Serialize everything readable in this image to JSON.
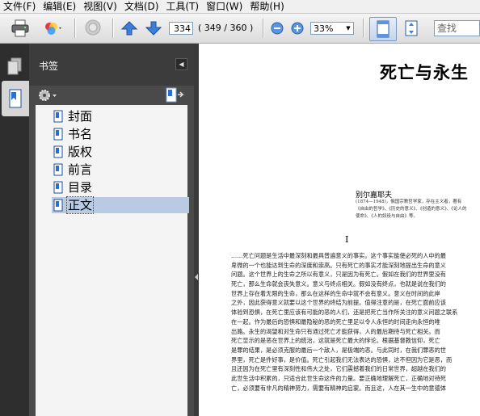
{
  "menu": [
    "文件(F)",
    "编辑(E)",
    "视图(V)",
    "文档(D)",
    "工具(T)",
    "窗口(W)",
    "帮助(H)"
  ],
  "toolbar": {
    "page_current": "334",
    "page_count": "( 349 / 360 )",
    "zoom": "33%",
    "find_placeholder": "查找",
    "icons": [
      "print-icon",
      "color-wheel-icon",
      "comment-icon",
      "previous-page-icon",
      "next-page-icon",
      "zoom-out-icon",
      "zoom-in-icon",
      "single-page-icon",
      "fit-page-icon"
    ]
  },
  "panel": {
    "title": "书签",
    "bookmarks": [
      {
        "label": "封面",
        "selected": false
      },
      {
        "label": "书名",
        "selected": false
      },
      {
        "label": "版权",
        "selected": false
      },
      {
        "label": "前言",
        "selected": false
      },
      {
        "label": "目录",
        "selected": false
      },
      {
        "label": "正文",
        "selected": true
      }
    ]
  },
  "document": {
    "title": "死亡与永生",
    "author": "别尔嘉耶夫",
    "author_note": "(1874—1948)，俄国宗教哲学家，存在主义者，著有《自由的哲学》、《历史的意义》、《创造的意义》、《论人的使命》、《人的奴役与自由》等。",
    "section": "I",
    "body_lines": [
      "……死亡问题是生活中最深刻和最具普遍意义的事实。这个事实能使必死的人中的最",
      "卑微的一个也能达到生命的深度和崇高。只有死亡的事实才能深刻地提出生命的意义",
      "问题。这个世界上的生命之所以有意义，只是因为有死亡。假如在我们的世界里没有",
      "死亡，那么生命就会丧失意义。意义与终点相关。假如没有终点，也就是说在我们的",
      "世界上存在着无限的生命，那么在这样的生命中就不会有意义。意义在时间的此岸",
      "之外，因此获得意义就要以这个世界的终结为前提。值得注意的是，在死亡面前应该",
      "体验到恐惧，在死亡里应该有可能的恶的人们，还是把死亡当作所关注的意义问题之联系",
      "在一起。作为最后的恐惧和最隐秘的恶的死亡里足以令人永恒的时间走向永恒的唯",
      "出路。永生的渴望和对生命只有通过死亡才能获得，人的最后期待与死亡相关。而",
      "死亡显示的是恶在世界上的统治，这就是死亡最大的悖论。根据基督教信仰，死亡",
      "是罪的结果，是必须克服的最后一个敌人，是极端的恶。与此同时，在我们罪恶的世",
      "界里，死亡是件好事，是价值。死亡引起我们无法表达的恐惧，这不但因为它是恶，而",
      "且还因为在死亡里有深刻性和伟大之处，它们震撼着我们的日常世界，超越在我们的",
      "此世生活中积累的，只适合此世生命这件的力量。要正确地理解死亡，正确地对待死",
      "亡，必须要有非凡的精神努力，需要有精神的启蒙。而且这，人在其一生中的意德体"
    ]
  }
}
